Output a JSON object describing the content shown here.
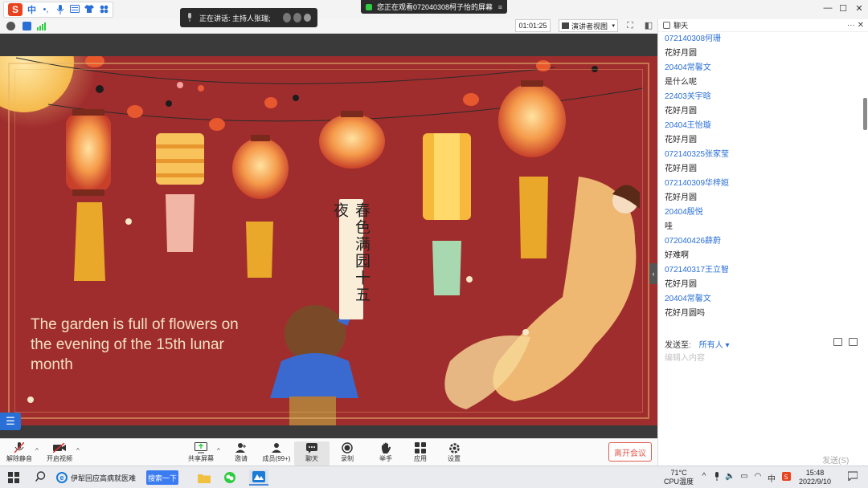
{
  "ime": {
    "logo": "S",
    "mode": "中",
    "punct": "•,",
    "mic": "🎤",
    "keyboard": "⌨",
    "skin": "👕",
    "grid": "▦"
  },
  "speaking": {
    "text": "正在讲话: 主持人张瑞;"
  },
  "viewing": {
    "text": "您正在观看072040308柯子怡的屏幕"
  },
  "toolbar": {
    "timer": "01:01:25",
    "view_mode": "演讲者视图"
  },
  "slide": {
    "caption": "The garden is full of flowers on the evening of the 15th lunar month",
    "poem": "春色满园十五夜",
    "colors": {
      "background": "#a02d2d",
      "lantern": "#f06a3a",
      "gold": "#e8a422"
    }
  },
  "chat": {
    "title": "聊天",
    "messages": [
      {
        "name": "072140308何珊",
        "text": "花好月圆"
      },
      {
        "name": "20404常馨文",
        "text": "是什么呢"
      },
      {
        "name": "22403关宇晗",
        "text": "花好月圆"
      },
      {
        "name": "20404王怡璇",
        "text": "花好月圆"
      },
      {
        "name": "072140325张家莹",
        "text": "花好月圆"
      },
      {
        "name": "072140309华梓姮",
        "text": "花好月圆"
      },
      {
        "name": "20404殷悦",
        "text": "哇"
      },
      {
        "name": "072040426薛蔚",
        "text": "好难啊"
      },
      {
        "name": "072140317王立智",
        "text": "花好月圆"
      },
      {
        "name": "20404常馨文",
        "text": "花好月圆吗"
      }
    ],
    "send_to_label": "发送至:",
    "send_to_value": "所有人",
    "input_placeholder": "编辑入内容",
    "send_button": "发送(S)"
  },
  "meeting_bar": {
    "unmute": "解除静音",
    "start_video": "开启视频",
    "share_screen": "共享屏幕",
    "invite": "邀请",
    "members": "成员(99+)",
    "chat": "聊天",
    "record": "录制",
    "raise_hand": "举手",
    "apps": "应用",
    "settings": "设置",
    "leave": "离开会议"
  },
  "taskbar": {
    "ie_title": "伊犁回应高病就医难",
    "search_button": "搜索一下",
    "temp": "71°C",
    "cpu": "CPU温度",
    "ime": "中",
    "time": "15:48",
    "date": "2022/9/10"
  }
}
